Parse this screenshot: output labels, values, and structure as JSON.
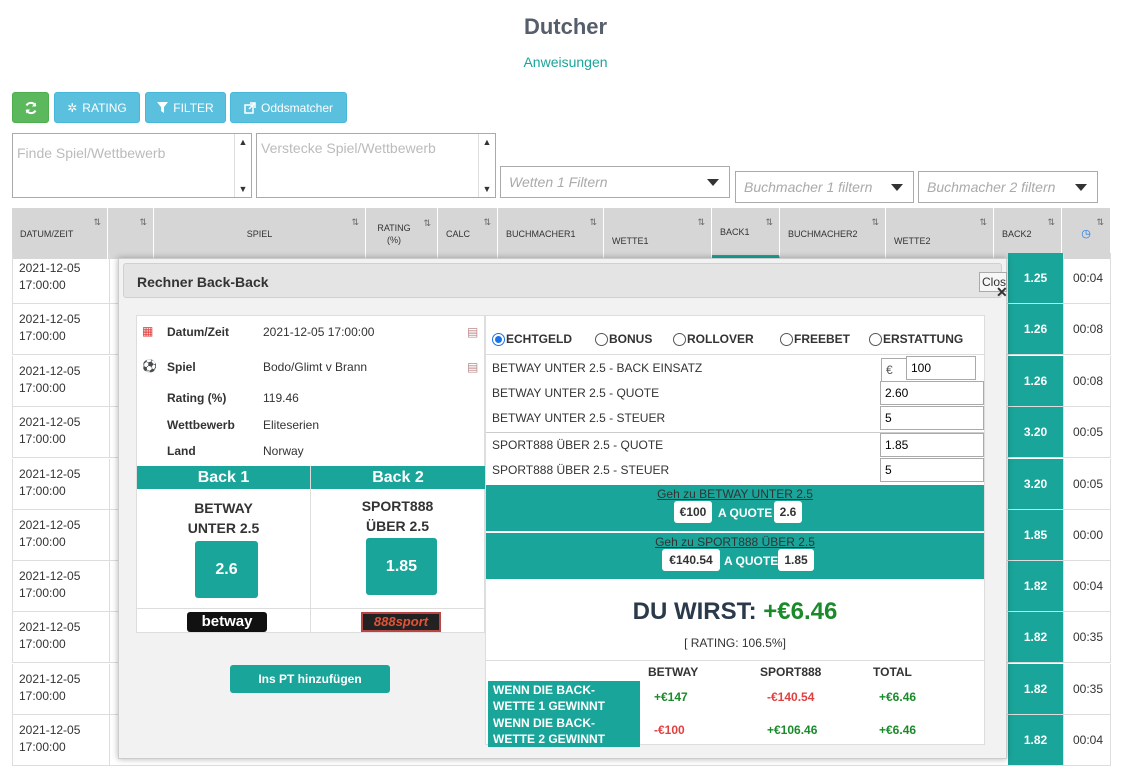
{
  "page": {
    "title": "Dutcher",
    "instructions_link": "Anweisungen"
  },
  "toolbar": {
    "refresh_icon": "refresh-icon",
    "rating_label": "RATING",
    "filter_label": "FILTER",
    "oddsmatcher_label": "Oddsmatcher"
  },
  "filters": {
    "find_placeholder": "Finde Spiel/Wettbewerb",
    "hide_placeholder": "Verstecke Spiel/Wettbewerb",
    "bet1_placeholder": "Wetten 1 Filtern",
    "bookmaker1_placeholder": "Buchmacher 1 filtern",
    "bookmaker2_placeholder": "Buchmacher 2 filtern"
  },
  "table": {
    "headers": [
      "DATUM/ZEIT",
      "",
      "SPIEL",
      "RATING (%)",
      "CALC",
      "BUCHMACHER1",
      "WETTE1",
      "BACK1",
      "BUCHMACHER2",
      "WETTE2",
      "BACK2",
      ""
    ],
    "rows": [
      {
        "date": "2021-12-05",
        "time": "17:00:00",
        "back2": "1.25",
        "updated": "00:04"
      },
      {
        "date": "2021-12-05",
        "time": "17:00:00",
        "back2": "1.26",
        "updated": "00:08"
      },
      {
        "date": "2021-12-05",
        "time": "17:00:00",
        "back2": "1.26",
        "updated": "00:08"
      },
      {
        "date": "2021-12-05",
        "time": "17:00:00",
        "back2": "3.20",
        "updated": "00:05"
      },
      {
        "date": "2021-12-05",
        "time": "17:00:00",
        "back2": "3.20",
        "updated": "00:05"
      },
      {
        "date": "2021-12-05",
        "time": "17:00:00",
        "back2": "1.85",
        "updated": "00:00"
      },
      {
        "date": "2021-12-05",
        "time": "17:00:00",
        "back2": "1.82",
        "updated": "00:04"
      },
      {
        "date": "2021-12-05",
        "time": "17:00:00",
        "back2": "1.82",
        "updated": "00:35"
      },
      {
        "date": "2021-12-05",
        "time": "17:00:00",
        "back2": "1.82",
        "updated": "00:35"
      },
      {
        "date": "2021-12-05",
        "time": "17:00:00",
        "back2": "1.82",
        "updated": "00:04"
      }
    ]
  },
  "modal": {
    "title": "Rechner Back-Back",
    "close_label": "Close",
    "info": {
      "datum_label": "Datum/Zeit",
      "datum_value": "2021-12-05 17:00:00",
      "spiel_label": "Spiel",
      "spiel_value": "Bodo/Glimt v Brann",
      "rating_label": "Rating (%)",
      "rating_value": "119.46",
      "wettbewerb_label": "Wettbewerb",
      "wettbewerb_value": "Eliteserien",
      "land_label": "Land",
      "land_value": "Norway"
    },
    "back1": {
      "header": "Back 1",
      "bookmaker": "BETWAY",
      "bet": "UNTER 2.5",
      "odds": "2.6",
      "logo_text": "betway"
    },
    "back2": {
      "header": "Back 2",
      "bookmaker": "SPORT888",
      "bet": "ÜBER 2.5",
      "odds": "1.85",
      "logo_text": "888sport"
    },
    "add_pt_button": "Ins PT hinzufügen",
    "modes": {
      "echtgeld": "ECHTGELD",
      "bonus": "BONUS",
      "rollover": "ROLLOVER",
      "freebet": "FREEBET",
      "erstattung": "ERSTATTUNG",
      "selected": "ECHTGELD"
    },
    "fields": {
      "stake_label": "BETWAY UNTER 2.5 - BACK EINSATZ",
      "currency": "€",
      "stake_value": "100",
      "quote1_label": "BETWAY UNTER 2.5 - QUOTE",
      "quote1_value": "2.60",
      "tax1_label": "BETWAY UNTER 2.5 - STEUER",
      "tax1_value": "5",
      "quote2_label": "SPORT888 ÜBER 2.5  - QUOTE",
      "quote2_value": "1.85",
      "tax2_label": "SPORT888 ÜBER 2.5 - STEUER",
      "tax2_value": "5"
    },
    "goto1": {
      "link": "Geh zu BETWAY UNTER 2.5",
      "amount": "€100",
      "aquote": "A QUOTE",
      "odds": "2.6"
    },
    "goto2": {
      "link": "Geh zu SPORT888 ÜBER 2.5",
      "amount": "€140.54",
      "aquote": "A QUOTE",
      "odds": "1.85"
    },
    "result": {
      "prefix": "DU WIRST:",
      "value": "+€6.46",
      "rating": "[ RATING: 106.5%]"
    },
    "summary": {
      "headers": [
        "BETWAY",
        "SPORT888",
        "TOTAL"
      ],
      "row1": {
        "label": "WENN DIE BACK-WETTE 1 GEWINNT",
        "betway": "+€147",
        "sport888": "-€140.54",
        "total": "+€6.46"
      },
      "row2": {
        "label": "WENN DIE BACK-WETTE 2 GEWINNT",
        "betway": "-€100",
        "sport888": "+€106.46",
        "total": "+€6.46"
      }
    }
  },
  "colors": {
    "accent": "#1aa59a",
    "green_button": "#5cb85c",
    "blue_button": "#5bc0de",
    "positive": "#1a8a2a",
    "negative": "#e04040"
  }
}
